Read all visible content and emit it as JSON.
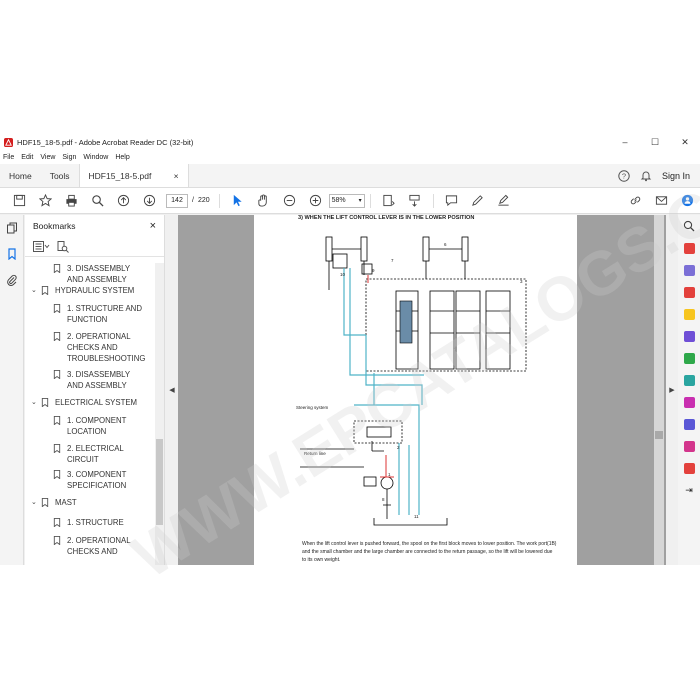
{
  "window": {
    "title": "HDF15_18-5.pdf - Adobe Acrobat Reader DC (32-bit)",
    "minimize": "–",
    "maximize": "☐",
    "close": "✕"
  },
  "menu": [
    "File",
    "Edit",
    "View",
    "Sign",
    "Window",
    "Help"
  ],
  "tabs": {
    "home": "Home",
    "tools": "Tools",
    "document": "HDF15_18-5.pdf",
    "doc_close": "×"
  },
  "account": {
    "help": "?",
    "signin": "Sign In"
  },
  "toolbar": {
    "page_current": "142",
    "page_sep": "/",
    "page_total": "220",
    "zoom": "58%"
  },
  "bookmarks": {
    "title": "Bookmarks",
    "close": "×",
    "items": [
      {
        "label": "3. DISASSEMBLY AND ASSEMBLY",
        "level": 2
      },
      {
        "label": "HYDRAULIC SYSTEM",
        "level": 1,
        "expanded": true
      },
      {
        "label": "1. STRUCTURE AND FUNCTION",
        "level": 2
      },
      {
        "label": "2. OPERATIONAL CHECKS AND TROUBLESHOOTING",
        "level": 2
      },
      {
        "label": "3. DISASSEMBLY AND ASSEMBLY",
        "level": 2
      },
      {
        "label": "ELECTRICAL SYSTEM",
        "level": 1,
        "expanded": true
      },
      {
        "label": "1. COMPONENT LOCATION",
        "level": 2
      },
      {
        "label": "2. ELECTRICAL CIRCUIT",
        "level": 2
      },
      {
        "label": "3. COMPONENT SPECIFICATION",
        "level": 2
      },
      {
        "label": "MAST",
        "level": 1,
        "expanded": true
      },
      {
        "label": "1. STRUCTURE",
        "level": 2
      },
      {
        "label": "2. OPERATIONAL CHECKS AND",
        "level": 2
      }
    ]
  },
  "document": {
    "heading": "3) WHEN THE LIFT CONTROL LEVER IS IN THE LOWER POSITION",
    "labels": {
      "steering": "Steering system",
      "return": "Return line",
      "n1": "1",
      "n2": "2",
      "n3": "3",
      "n6": "6",
      "n7": "7",
      "n8": "8",
      "n9": "9",
      "n10": "10",
      "n11": "11"
    },
    "body": "When the lift control lever is pushed forward, the spool on the first block moves to lower position. The work port(1B) and the small chamber and the large chamber are connected to the return passage, so the lift will be lowered due to its own weight."
  },
  "watermark": "WWW.EPCATALOGS.COM",
  "colors": {
    "accent": "#1473e6",
    "circuit_blue": "#4fb3c8",
    "circuit_red": "#d33"
  }
}
